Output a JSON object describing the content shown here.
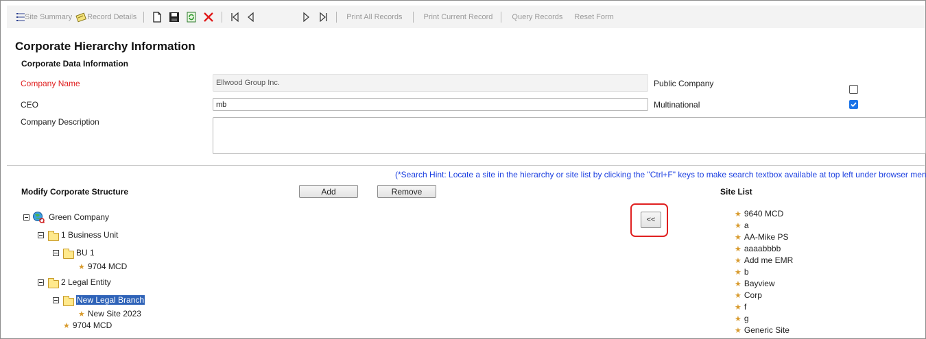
{
  "toolbar": {
    "site_summary": "Site Summary",
    "record_details": "Record Details",
    "print_all": "Print All Records",
    "print_current": "Print Current Record",
    "query_records": "Query Records",
    "reset_form": "Reset Form"
  },
  "page_title": "Corporate Hierarchy Information",
  "corp_data": {
    "section_title": "Corporate Data Information",
    "company_name_label": "Company Name",
    "company_name_value": "Ellwood Group Inc.",
    "ceo_label": "CEO",
    "ceo_value": "mb",
    "description_label": "Company Description",
    "description_value": "",
    "public_company_label": "Public Company",
    "public_company_checked": false,
    "multinational_label": "Multinational",
    "multinational_checked": true
  },
  "structure": {
    "hint": "(*Search Hint: Locate a site in the hierarchy or site list by clicking the \"Ctrl+F\" keys to make search textbox available at top left under browser menu)",
    "section_title": "Modify Corporate Structure",
    "add_label": "Add",
    "remove_label": "Remove",
    "move_left_label": "<<",
    "site_list_title": "Site List"
  },
  "tree": {
    "root": "Green Company",
    "business_unit": "1 Business Unit",
    "bu1": "BU 1",
    "bu1_site": "9704 MCD",
    "legal_entity": "2 Legal Entity",
    "new_legal_branch": "New Legal Branch",
    "new_site": "New Site 2023",
    "legal_site": "9704 MCD"
  },
  "site_list": [
    "9640 MCD",
    "a",
    "AA-Mike PS",
    "aaaabbbb",
    "Add me EMR",
    "b",
    "Bayview",
    "Corp",
    "f",
    "g",
    "Generic Site"
  ]
}
